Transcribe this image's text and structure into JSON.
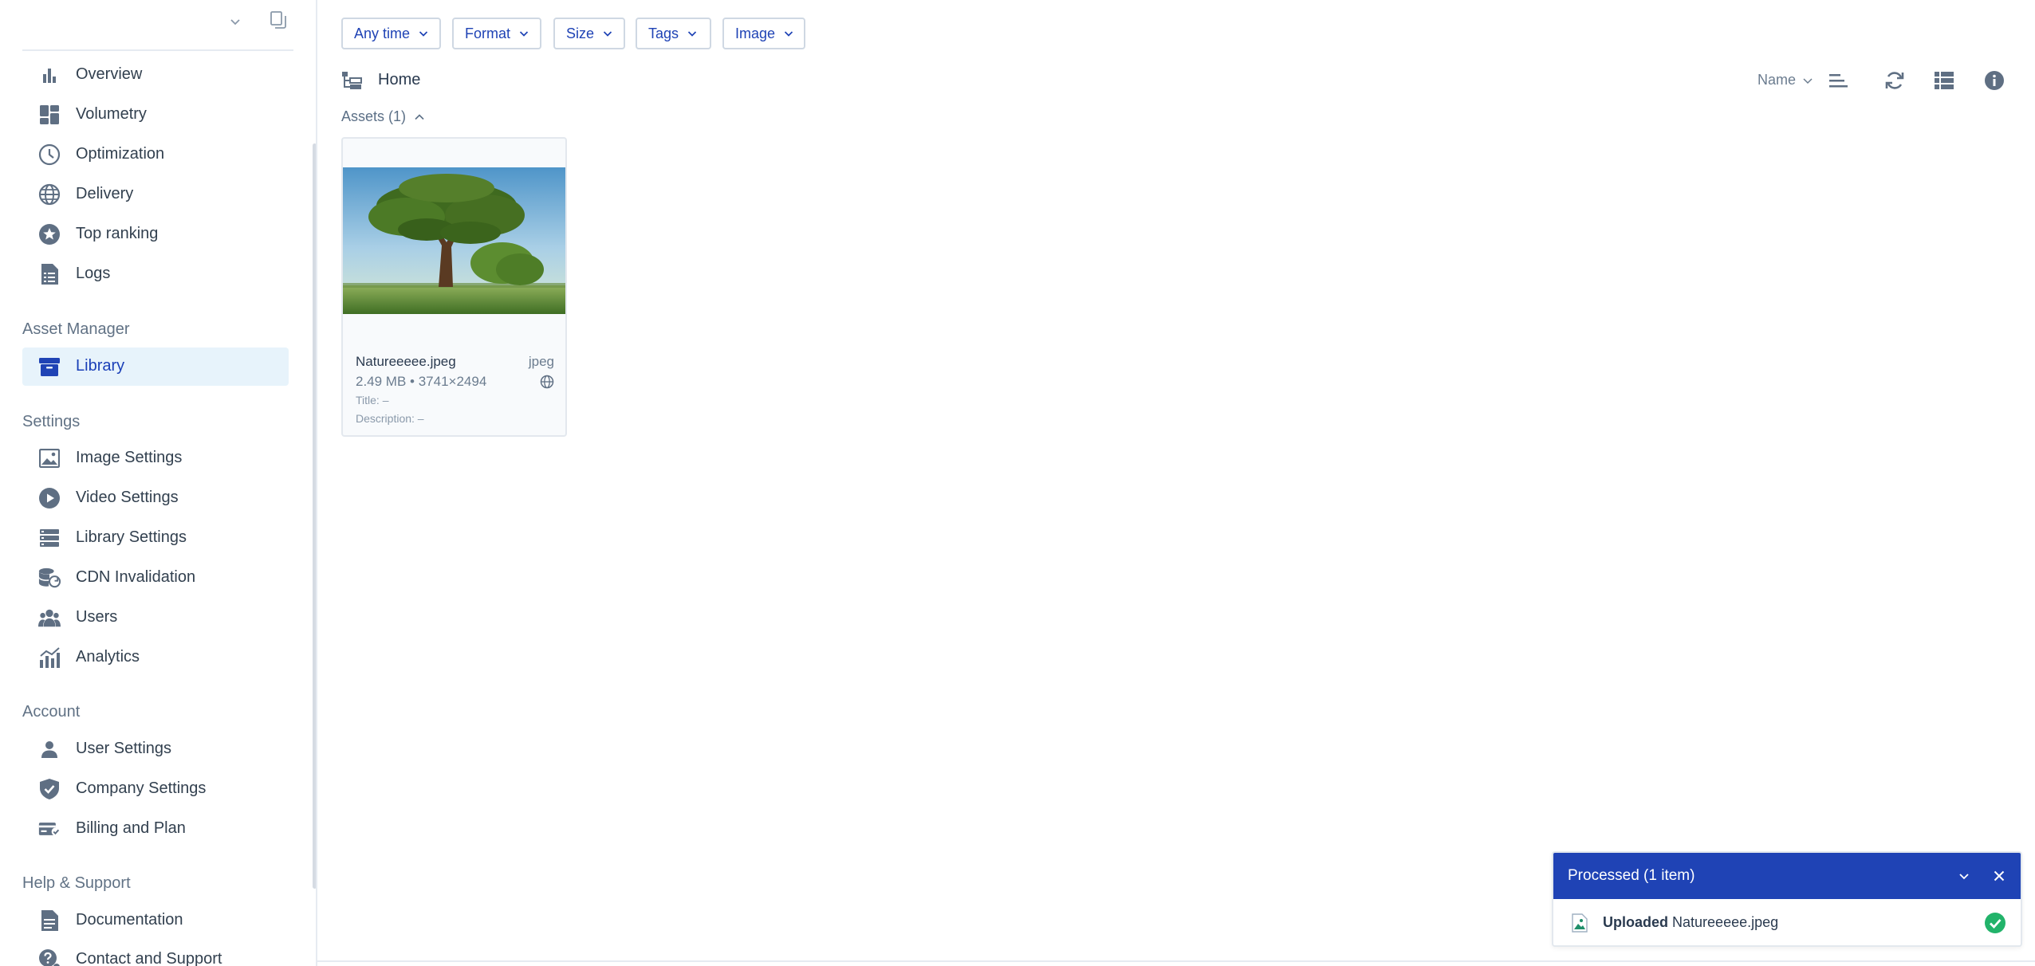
{
  "sidebar": {
    "top_nav": [
      {
        "label": "Overview",
        "icon": "bar-chart-icon"
      },
      {
        "label": "Volumetry",
        "icon": "grid-icon"
      },
      {
        "label": "Optimization",
        "icon": "clock-icon"
      },
      {
        "label": "Delivery",
        "icon": "globe-icon"
      },
      {
        "label": "Top ranking",
        "icon": "star-icon"
      },
      {
        "label": "Logs",
        "icon": "log-document-icon"
      }
    ],
    "asset_manager": {
      "heading": "Asset Manager",
      "items": [
        {
          "label": "Library",
          "icon": "archive-box-icon",
          "active": true
        }
      ]
    },
    "settings": {
      "heading": "Settings",
      "items": [
        {
          "label": "Image Settings",
          "icon": "image-icon"
        },
        {
          "label": "Video Settings",
          "icon": "play-circle-icon"
        },
        {
          "label": "Library Settings",
          "icon": "list-settings-icon"
        },
        {
          "label": "CDN Invalidation",
          "icon": "database-refresh-icon"
        },
        {
          "label": "Users",
          "icon": "users-icon"
        },
        {
          "label": "Analytics",
          "icon": "analytics-icon"
        }
      ]
    },
    "account": {
      "heading": "Account",
      "items": [
        {
          "label": "User Settings",
          "icon": "user-icon"
        },
        {
          "label": "Company Settings",
          "icon": "shield-check-icon"
        },
        {
          "label": "Billing and Plan",
          "icon": "billing-icon"
        }
      ]
    },
    "help": {
      "heading": "Help & Support",
      "items": [
        {
          "label": "Documentation",
          "icon": "document-icon"
        },
        {
          "label": "Contact and Support",
          "icon": "help-chat-icon"
        }
      ]
    }
  },
  "filters": [
    "Any time",
    "Format",
    "Size",
    "Tags",
    "Image"
  ],
  "toolbar": {
    "breadcrumb": "Home",
    "sort_label": "Name"
  },
  "assets": {
    "group_label": "Assets (1)",
    "items": [
      {
        "name": "Natureeeee.jpeg",
        "ext": "jpeg",
        "meta": "2.49 MB • 3741×2494",
        "title": "Title: –",
        "description": "Description: –"
      }
    ]
  },
  "toast": {
    "title": "Processed (1 item)",
    "status_word": "Uploaded",
    "file": "Natureeeee.jpeg"
  },
  "colors": {
    "accent": "#1f43b5",
    "active_bg": "#e7f3fb",
    "icon": "#5f6f83",
    "success": "#22b36a"
  }
}
